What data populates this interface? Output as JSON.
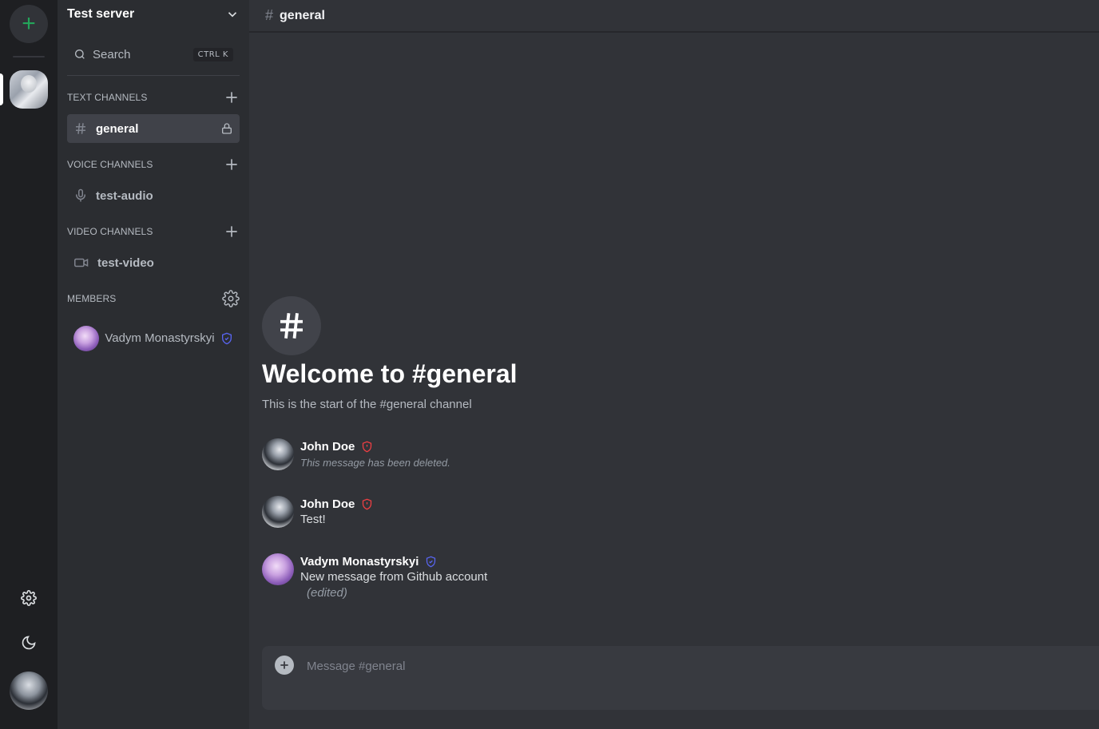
{
  "rail": {
    "add_server_glyph": "+",
    "server_icon": "server-avatar",
    "settings_icon": "gear-icon",
    "theme_icon": "moon-icon",
    "user_avatar": "user-avatar"
  },
  "sidebar": {
    "server_name": "Test server",
    "search": {
      "label": "Search",
      "shortcut": "CTRL K"
    },
    "categories": [
      {
        "label": "TEXT CHANNELS",
        "channels": [
          {
            "label": "general",
            "icon": "hash-icon",
            "locked": true,
            "active": true
          }
        ]
      },
      {
        "label": "VOICE CHANNELS",
        "channels": [
          {
            "label": "test-audio",
            "icon": "microphone-icon"
          }
        ]
      },
      {
        "label": "VIDEO CHANNELS",
        "channels": [
          {
            "label": "test-video",
            "icon": "video-camera-icon"
          }
        ]
      }
    ],
    "members": {
      "label": "MEMBERS",
      "items": [
        {
          "name": "Vadym Monastyrskyi",
          "badge_color": "#5865f2"
        }
      ]
    }
  },
  "main": {
    "channel_title": "general",
    "welcome": {
      "title": "Welcome to #general",
      "subtitle": "This is the start of the #general channel"
    },
    "messages": [
      {
        "author": "John Doe",
        "badge_color": "#f23f43",
        "text": "This message has been deleted.",
        "deleted": true
      },
      {
        "author": "John Doe",
        "badge_color": "#f23f43",
        "text": "Test!"
      },
      {
        "author": "Vadym Monastyrskyi",
        "badge_color": "#5865f2",
        "text": "New message from Github account",
        "edited_label": "(edited)"
      }
    ],
    "composer": {
      "placeholder": "Message #general"
    }
  },
  "colors": {
    "accent_green": "#23a55a",
    "admin_red": "#f23f43",
    "moderator_blurple": "#5865f2"
  }
}
